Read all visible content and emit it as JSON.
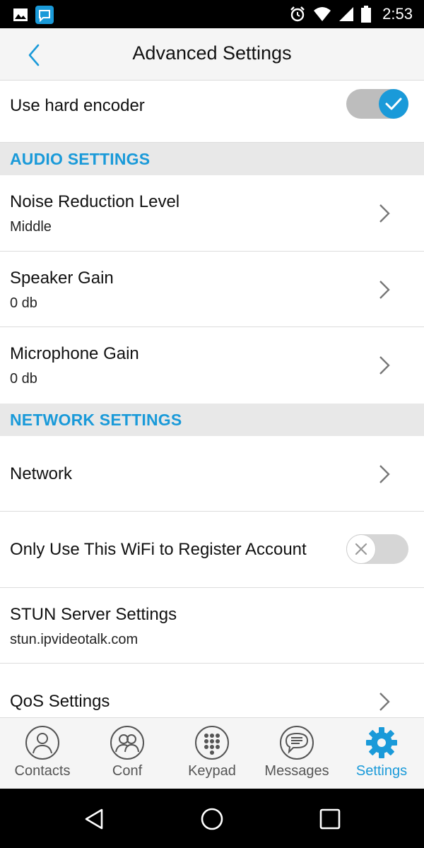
{
  "status_bar": {
    "time": "2:53"
  },
  "header": {
    "title": "Advanced Settings"
  },
  "hard_encoder": {
    "label": "Use hard encoder",
    "enabled": true
  },
  "audio": {
    "section_title": "AUDIO SETTINGS",
    "noise_reduction": {
      "label": "Noise Reduction Level",
      "value": "Middle"
    },
    "speaker_gain": {
      "label": "Speaker Gain",
      "value": "0 db"
    },
    "microphone_gain": {
      "label": "Microphone Gain",
      "value": "0 db"
    }
  },
  "network": {
    "section_title": "NETWORK SETTINGS",
    "network": {
      "label": "Network"
    },
    "only_wifi": {
      "label": "Only Use This WiFi to Register Account",
      "enabled": false
    },
    "stun": {
      "label": "STUN Server Settings",
      "value": "stun.ipvideotalk.com"
    },
    "qos": {
      "label": "QoS Settings"
    }
  },
  "tabs": [
    {
      "label": "Contacts",
      "icon": "contacts-icon",
      "active": false
    },
    {
      "label": "Conf",
      "icon": "conference-icon",
      "active": false
    },
    {
      "label": "Keypad",
      "icon": "keypad-icon",
      "active": false
    },
    {
      "label": "Messages",
      "icon": "messages-icon",
      "active": false
    },
    {
      "label": "Settings",
      "icon": "settings-gear-icon",
      "active": true
    }
  ],
  "colors": {
    "accent": "#1a9ad9",
    "section_bg": "#e8e8e8",
    "toggle_on_track": "#bdbdbd",
    "toggle_off_track": "#d6d6d6"
  }
}
